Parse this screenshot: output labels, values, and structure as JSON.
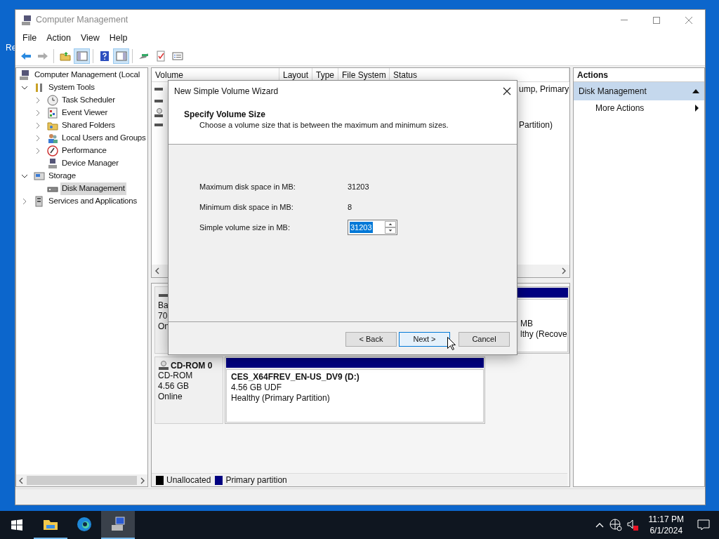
{
  "desktop": {
    "icon_label": "Re"
  },
  "window": {
    "title": "Computer Management"
  },
  "menu": [
    "File",
    "Action",
    "View",
    "Help"
  ],
  "toolbar": [
    {
      "pressed": false,
      "disabled": false
    },
    {
      "pressed": false,
      "disabled": true
    },
    {
      "pressed": false,
      "disabled": false
    },
    {
      "pressed": true,
      "disabled": false
    },
    {
      "pressed": false,
      "disabled": false
    },
    {
      "pressed": true,
      "disabled": false
    },
    {
      "pressed": false,
      "disabled": false
    },
    {
      "pressed": false,
      "disabled": false
    },
    {
      "pressed": false,
      "disabled": false
    }
  ],
  "tree": {
    "root": "Computer Management (Local",
    "children": [
      {
        "label": "System Tools",
        "expanded": true,
        "selected": false,
        "children": [
          {
            "label": "Task Scheduler",
            "expanded": false,
            "selected": false
          },
          {
            "label": "Event Viewer",
            "expanded": false,
            "selected": false
          },
          {
            "label": "Shared Folders",
            "expanded": false,
            "selected": false
          },
          {
            "label": "Local Users and Groups",
            "expanded": false,
            "selected": false
          },
          {
            "label": "Performance",
            "expanded": false,
            "selected": false
          },
          {
            "label": "Device Manager",
            "selected": false
          }
        ]
      },
      {
        "label": "Storage",
        "expanded": true,
        "selected": false,
        "children": [
          {
            "label": "Disk Management",
            "selected": true
          }
        ]
      },
      {
        "label": "Services and Applications",
        "expanded": false,
        "selected": false
      }
    ]
  },
  "volume_list": {
    "columns": [
      "Volume",
      "Layout",
      "Type",
      "File System",
      "Status"
    ],
    "rows": [
      {
        "kind": "disk",
        "status": "ump, Primary"
      },
      {
        "kind": "disk"
      },
      {
        "kind": "cd"
      },
      {
        "kind": "disk",
        "status": "Partition)"
      }
    ]
  },
  "disks": [
    {
      "kind": "disk",
      "lines": [
        "Ba",
        "70",
        "On"
      ],
      "partitions": [
        {
          "color": "#000080",
          "lines": [
            "MB",
            "lthy (Recove"
          ]
        }
      ]
    },
    {
      "kind": "cd",
      "title": "CD-ROM 0",
      "lines": [
        "CD-ROM",
        "4.56 GB",
        "Online"
      ],
      "partitions": [
        {
          "color": "#000080",
          "title": "CES_X64FREV_EN-US_DV9  (D:)",
          "lines": [
            "4.56 GB UDF",
            "Healthy (Primary Partition)"
          ]
        }
      ]
    }
  ],
  "legend": [
    {
      "label": "Unallocated",
      "color": "#000000"
    },
    {
      "label": "Primary partition",
      "color": "#000080"
    }
  ],
  "actions": {
    "title": "Actions",
    "groups": [
      {
        "label": "Disk Management",
        "expanded": true,
        "items": [
          "More Actions"
        ]
      }
    ]
  },
  "wizard": {
    "title": "New Simple Volume Wizard",
    "heading": "Specify Volume Size",
    "subtitle": "Choose a volume size that is between the maximum and minimum sizes.",
    "fields": [
      {
        "kind": "readout",
        "label": "Maximum disk space in MB:",
        "value": "31203"
      },
      {
        "kind": "readout",
        "label": "Minimum disk space in MB:",
        "value": "8"
      },
      {
        "kind": "spin",
        "label": "Simple volume size in MB:",
        "value": "31203",
        "selected": true
      }
    ],
    "buttons": [
      {
        "label": "< Back",
        "focused": false
      },
      {
        "label": "Next >",
        "focused": true
      },
      {
        "label": "Cancel",
        "focused": false
      }
    ]
  },
  "taskbar": {
    "apps": [
      {
        "running": true,
        "active": false
      },
      {
        "running": false,
        "active": false
      },
      {
        "running": true,
        "active": true
      }
    ],
    "time": "11:17 PM",
    "date": "6/1/2024"
  }
}
